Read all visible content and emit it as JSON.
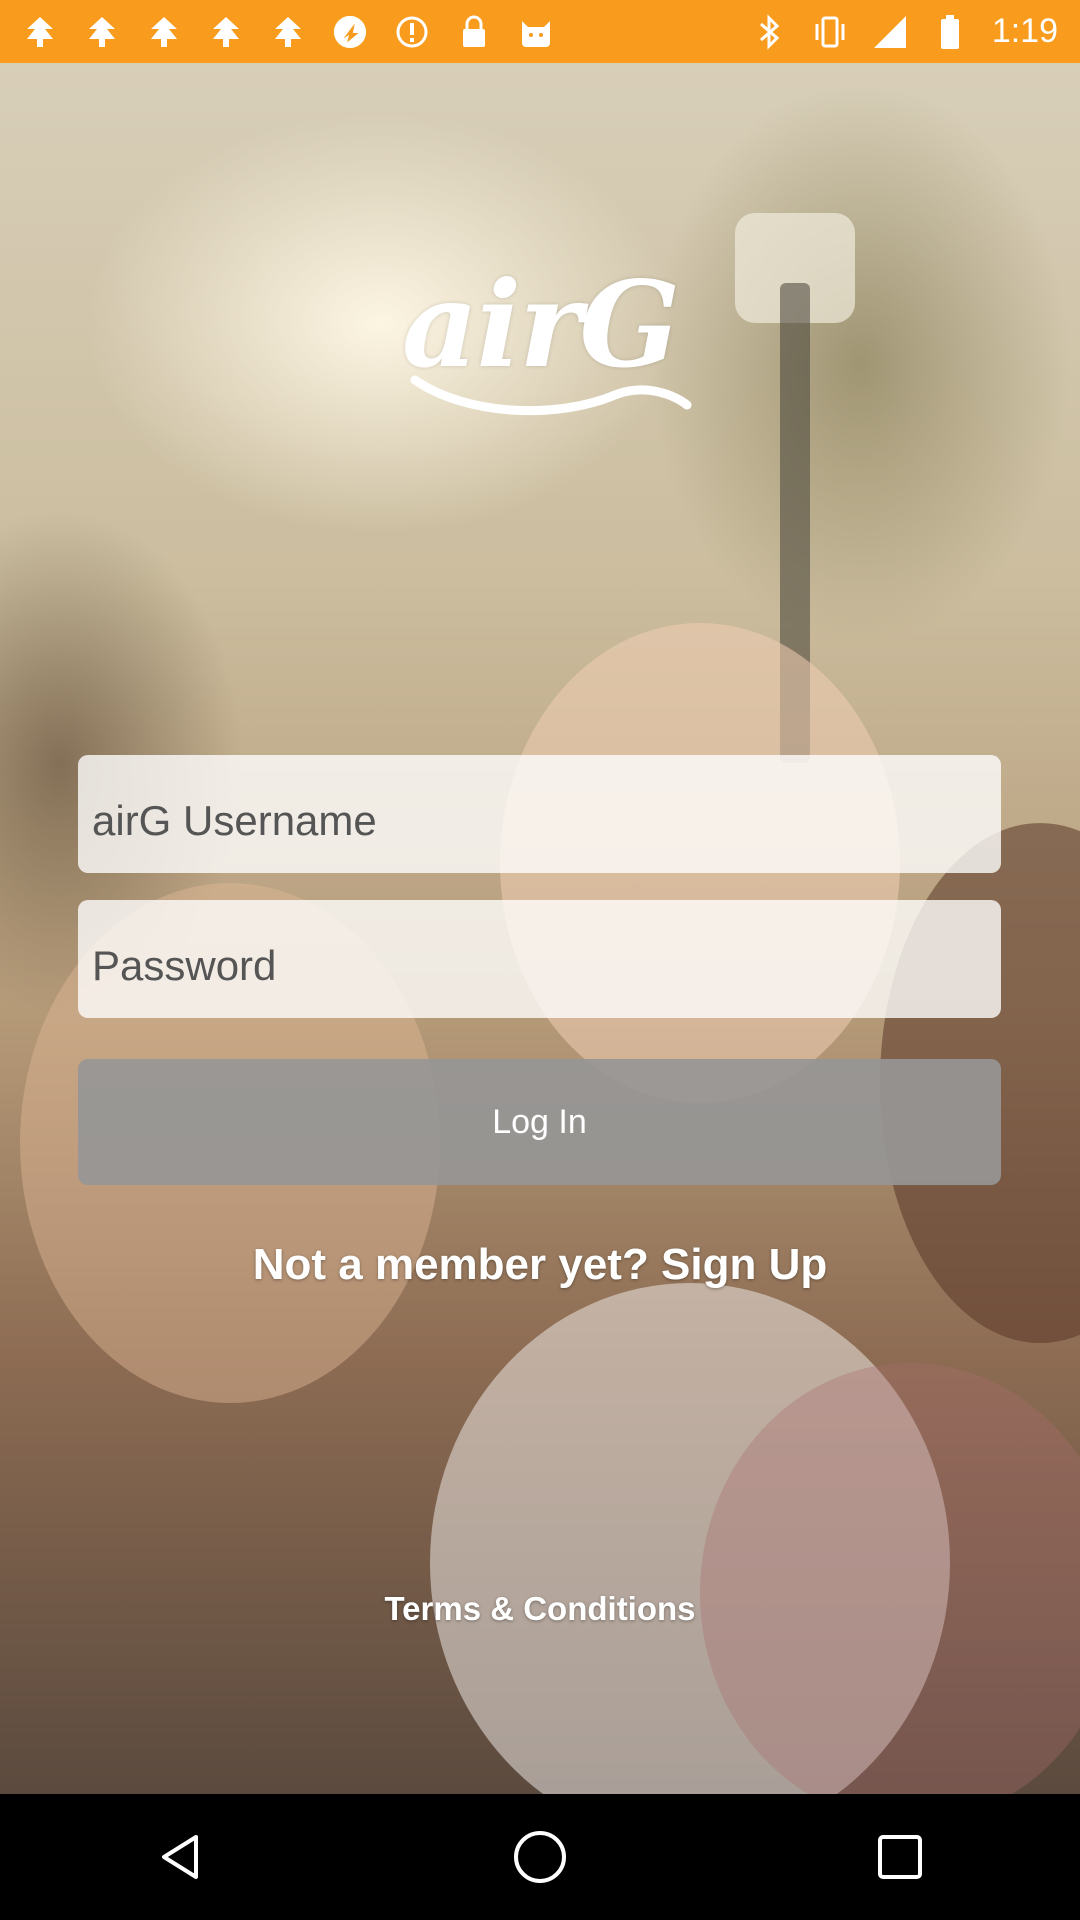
{
  "status_bar": {
    "time": "1:19",
    "left_icons": [
      "tree-icon",
      "tree-icon",
      "tree-icon",
      "tree-icon",
      "tree-icon",
      "nav-app-icon",
      "alert-icon",
      "lock-icon",
      "cat-icon"
    ],
    "right_icons": [
      "bluetooth-icon",
      "vibrate-icon",
      "signal-icon",
      "battery-icon"
    ],
    "color": "#f99b1c"
  },
  "logo": {
    "text": "airG"
  },
  "form": {
    "username_placeholder": "airG Username",
    "password_placeholder": "Password",
    "login_label": "Log In"
  },
  "links": {
    "signup": "Not a member yet? Sign Up",
    "terms": "Terms & Conditions"
  },
  "nav_bar": {
    "icons": [
      "back-icon",
      "home-icon",
      "recents-icon"
    ]
  }
}
